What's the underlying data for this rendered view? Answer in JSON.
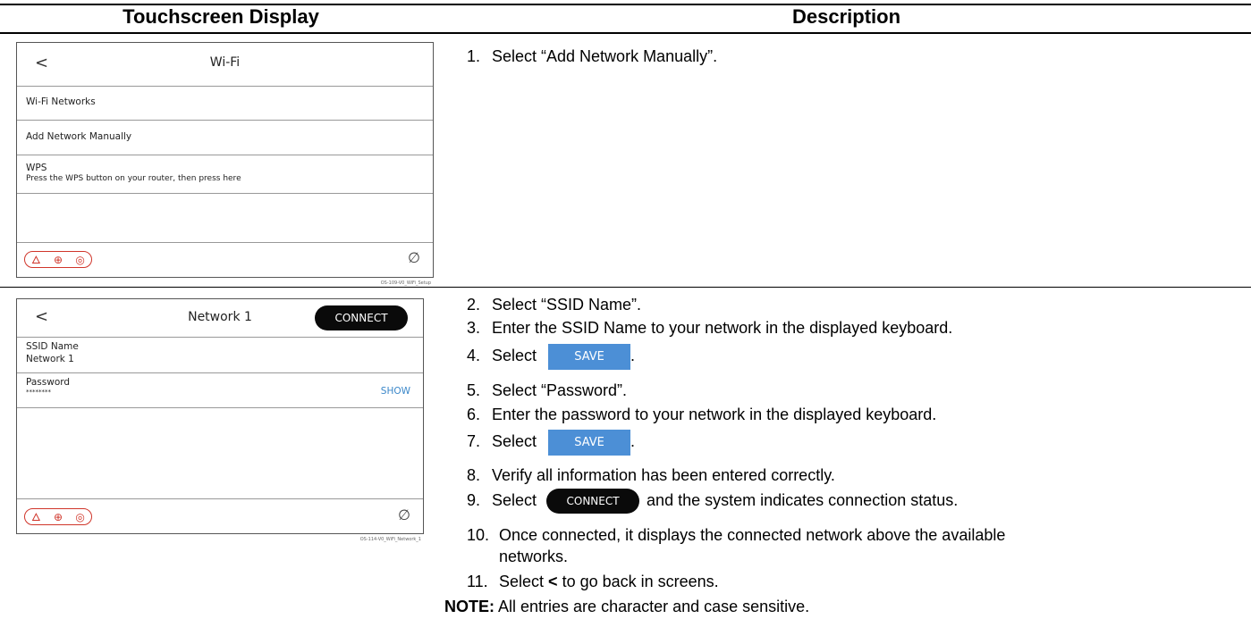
{
  "header": {
    "col1": "Touchscreen Display",
    "col2": "Description"
  },
  "screen1": {
    "back": "<",
    "title": "Wi-Fi",
    "rows": [
      "Wi-Fi Networks",
      "Add Network Manually"
    ],
    "wps_title": "WPS",
    "wps_subtitle": "Press the WPS button on your router, then press here",
    "tag": "OS-109-V0_WiFi_Setup"
  },
  "screen2": {
    "back": "<",
    "title": "Network 1",
    "connect": "CONNECT",
    "ssid_label": "SSID Name",
    "ssid_value": "Network 1",
    "password_label": "Password",
    "password_value": "********",
    "show": "SHOW",
    "tag": "OS-114-V0_WiFi_Network_1"
  },
  "icons": {
    "fire": "fire-icon",
    "medical": "medical-icon",
    "police": "police-icon",
    "no_signal": "no-signal-icon"
  },
  "colors": {
    "emergency_red": "#d0352a",
    "save_blue": "#4c8fd6",
    "show_blue": "#3a87c9",
    "connect_black": "#0a0a0a"
  },
  "steps": {
    "s1": {
      "num": "1.",
      "text": "Select “Add Network Manually”."
    },
    "s2": {
      "num": "2.",
      "text": "Select “SSID Name”."
    },
    "s3": {
      "num": "3.",
      "text": "Enter the SSID Name to your network in the displayed keyboard."
    },
    "s4": {
      "num": "4.",
      "pre": "Select",
      "btn": "SAVE",
      "post": "."
    },
    "s5": {
      "num": "5.",
      "text": "Select “Password”."
    },
    "s6": {
      "num": "6.",
      "text": "Enter the password to your network in the displayed keyboard."
    },
    "s7": {
      "num": "7.",
      "pre": "Select",
      "btn": "SAVE",
      "post": "."
    },
    "s8": {
      "num": "8.",
      "text": "Verify all information has been entered correctly."
    },
    "s9": {
      "num": "9.",
      "pre": "Select",
      "btn": "CONNECT",
      "post": "and the system indicates connection status."
    },
    "s10": {
      "num": "10.",
      "line1": "Once connected, it displays the connected network above the available",
      "line2": "networks."
    },
    "s11": {
      "num": "11.",
      "pre": "Select",
      "bold": "<",
      "post": "to go back in screens."
    }
  },
  "note": {
    "label": "NOTE:",
    "text": "All entries are character and case sensitive."
  }
}
